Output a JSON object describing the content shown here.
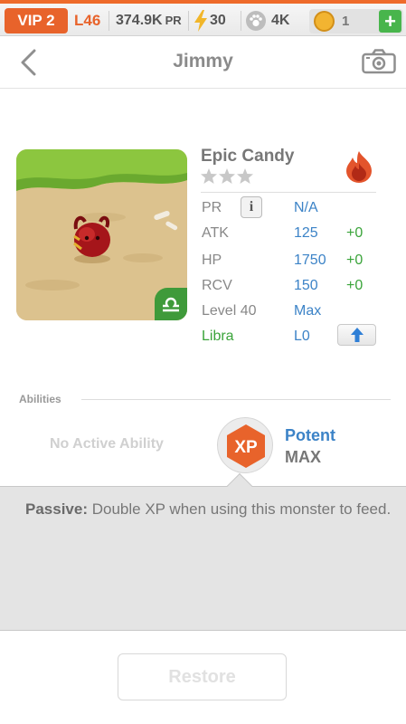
{
  "topbar": {
    "vip": "VIP 2",
    "level": "L46",
    "pr_value": "374.9K",
    "pr_unit": "PR",
    "energy": "30",
    "paws": "4K",
    "coins": "1",
    "add_label": "+",
    "accent_color": "#e8632b"
  },
  "header": {
    "title": "Jimmy",
    "icons": [
      "chevron-left-icon",
      "camera-icon"
    ]
  },
  "monster": {
    "name": "Epic Candy",
    "stars": 3,
    "element": "fire",
    "zodiac": "libra",
    "stats": [
      {
        "label": "PR",
        "value": "N/A",
        "bonus": ""
      },
      {
        "label": "ATK",
        "value": "125",
        "bonus": "+0"
      },
      {
        "label": "HP",
        "value": "1750",
        "bonus": "+0"
      },
      {
        "label": "RCV",
        "value": "150",
        "bonus": "+0"
      },
      {
        "label": "Level 40",
        "value": "Max",
        "bonus": ""
      },
      {
        "label": "Libra",
        "value": "L0",
        "bonus": ""
      }
    ],
    "info_label": "i"
  },
  "abilities": {
    "section_label": "Abilities",
    "active": "No Active Ability",
    "badge_text": "XP",
    "passive_name": "Potent",
    "passive_level": "MAX",
    "passive_title": "Passive:",
    "passive_desc": " Double XP when using this monster to feed."
  },
  "footer": {
    "restore_label": "Restore"
  },
  "colors": {
    "blue": "#3c83c7",
    "green": "#3aa43a",
    "gray_text": "#888888",
    "xp_orange": "#e8632b"
  }
}
